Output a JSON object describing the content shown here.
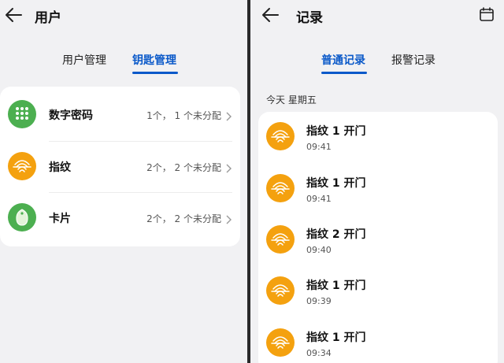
{
  "left": {
    "title": "用户",
    "tabs": [
      {
        "label": "用户管理",
        "active": false
      },
      {
        "label": "钥匙管理",
        "active": true
      }
    ],
    "items": [
      {
        "label": "数字密码",
        "count": "1个， 1 个未分配",
        "icon": "keypad-icon",
        "color": "#4caf50"
      },
      {
        "label": "指纹",
        "count": "2个， 2 个未分配",
        "icon": "fingerprint-icon",
        "color": "#f4a10f"
      },
      {
        "label": "卡片",
        "count": "2个， 2 个未分配",
        "icon": "card-tag-icon",
        "color": "#4caf50"
      }
    ]
  },
  "right": {
    "title": "记录",
    "tabs": [
      {
        "label": "普通记录",
        "active": true
      },
      {
        "label": "报警记录",
        "active": false
      }
    ],
    "date": "今天 星期五",
    "records": [
      {
        "title": "指纹 1 开门",
        "time": "09:41"
      },
      {
        "title": "指纹 1 开门",
        "time": "09:41"
      },
      {
        "title": "指纹 2 开门",
        "time": "09:40"
      },
      {
        "title": "指纹 1 开门",
        "time": "09:39"
      },
      {
        "title": "指纹 1 开门",
        "time": "09:34"
      }
    ]
  },
  "colors": {
    "accent": "#0a59c9",
    "green": "#4caf50",
    "orange": "#f4a10f",
    "background": "#f1f1f3"
  }
}
